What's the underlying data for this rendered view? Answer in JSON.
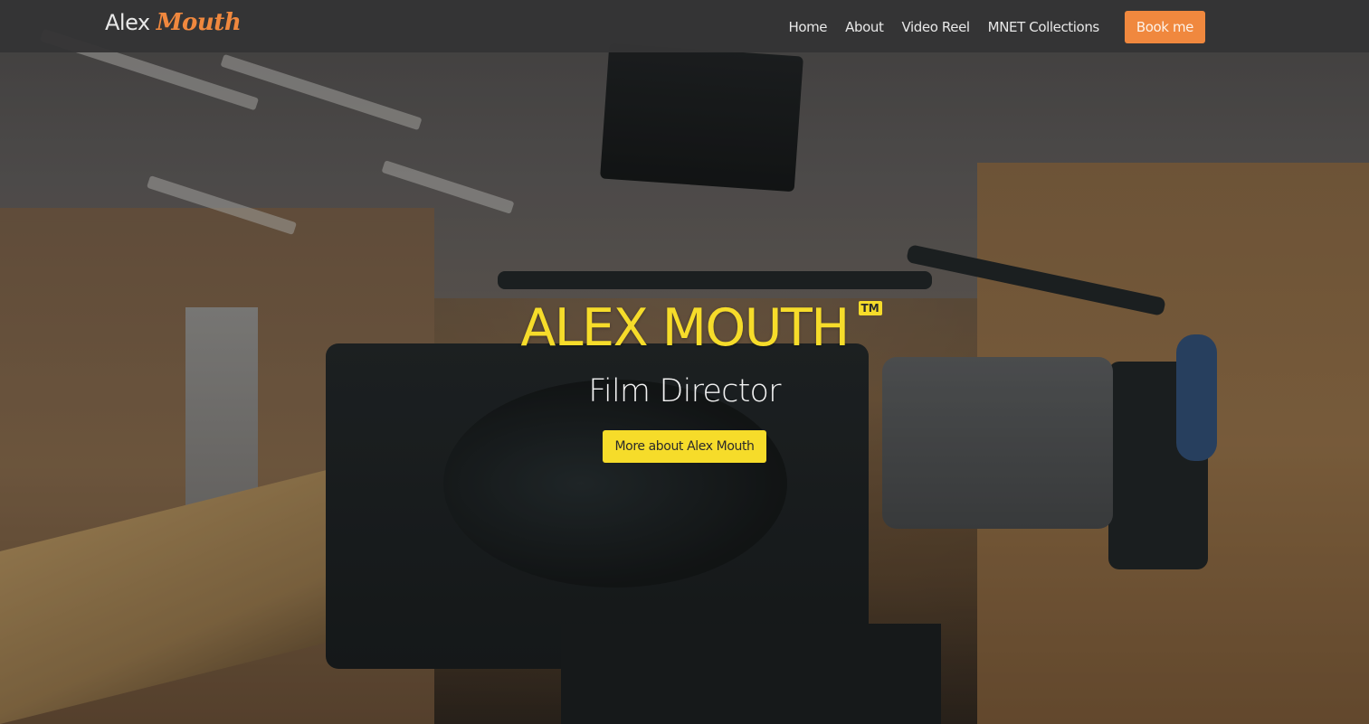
{
  "nav": {
    "brand_first": "Alex",
    "brand_second": "Mouth",
    "links": [
      "Home",
      "About",
      "Video Reel",
      "MNET Collections"
    ],
    "cta_label": "Book me"
  },
  "hero": {
    "title": "ALEX MOUTH",
    "badge": "TM",
    "subtitle": "Film Director",
    "button_label": "More about Alex Mouth"
  },
  "colors": {
    "accent_orange": "#f0883e",
    "accent_yellow": "#f6dc2a",
    "navbar": "#343435"
  }
}
